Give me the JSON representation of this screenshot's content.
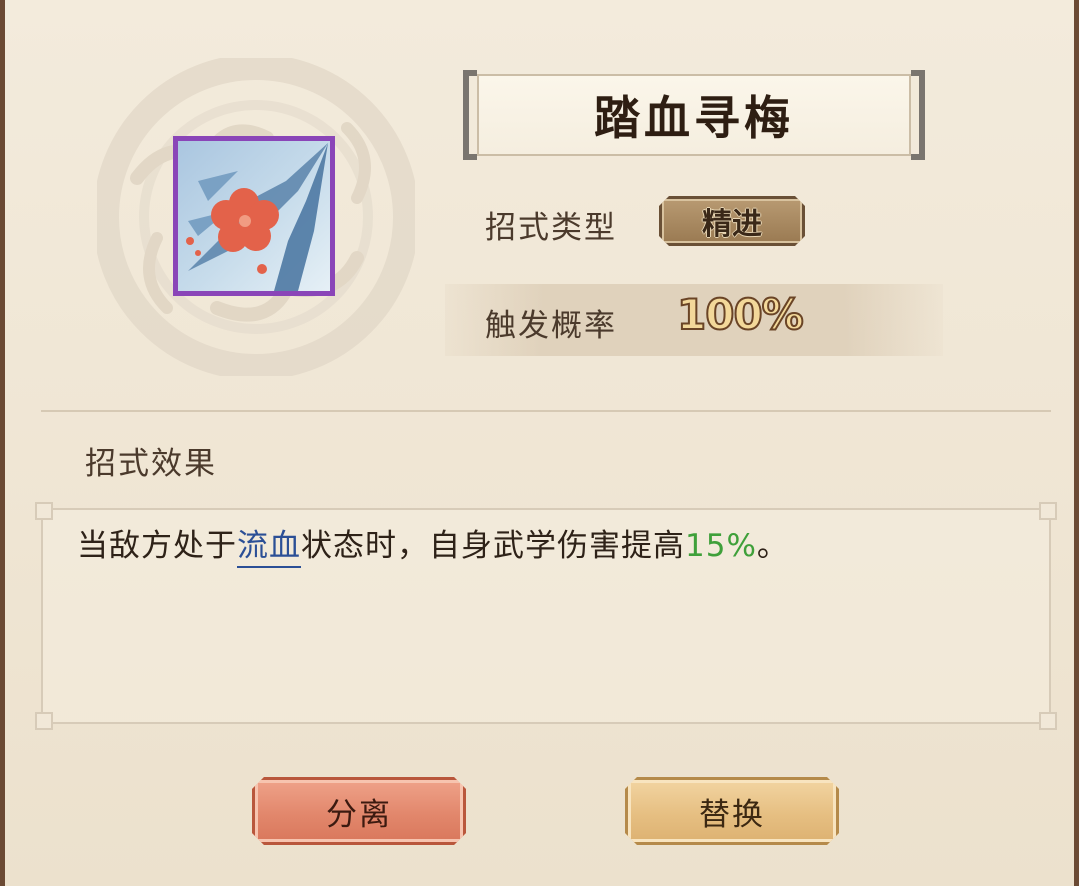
{
  "skill": {
    "name": "踏血寻梅",
    "icon": "blood-plum-blossom-icon",
    "type_label": "招式类型",
    "type_value": "精进",
    "trigger_label": "触发概率",
    "trigger_value": "100%"
  },
  "effect": {
    "section_title": "招式效果",
    "text_before": "当敌方处于",
    "keyword": "流血",
    "text_middle": "状态时，自身武学伤害提高",
    "percent": "15%",
    "text_after": "。"
  },
  "buttons": {
    "split_label": "分离",
    "replace_label": "替换"
  },
  "colors": {
    "keyword": "#2b4f96",
    "percent": "#3fa03a",
    "icon_border": "#8a45b8",
    "split_button": "#e2876c",
    "replace_button": "#e6bf82"
  }
}
